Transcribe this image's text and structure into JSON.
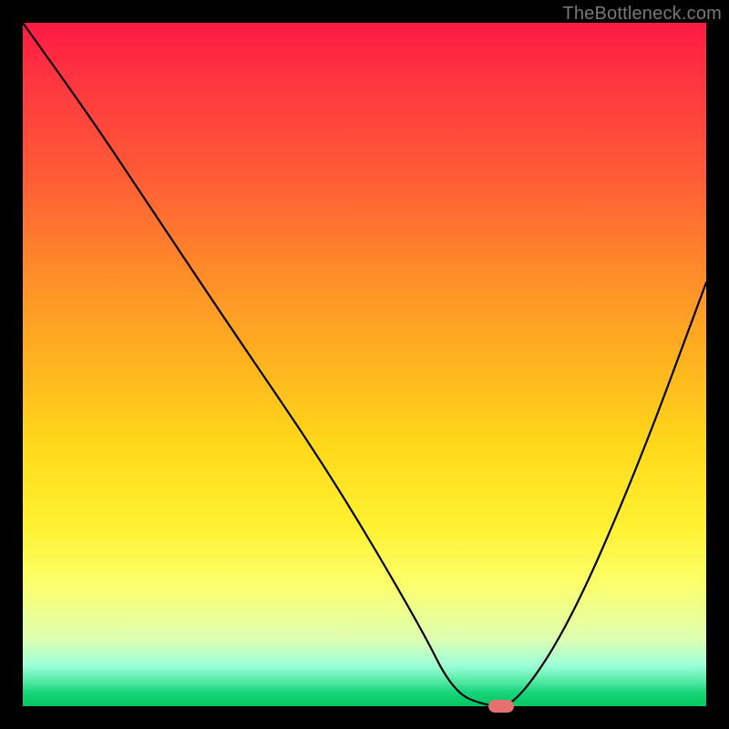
{
  "watermark": "TheBottleneck.com",
  "chart_data": {
    "type": "line",
    "title": "",
    "xlabel": "",
    "ylabel": "",
    "xlim": [
      0,
      100
    ],
    "ylim": [
      0,
      100
    ],
    "grid": false,
    "background": "red-yellow-green vertical gradient",
    "series": [
      {
        "name": "bottleneck-curve",
        "x": [
          0,
          10,
          18,
          30,
          45,
          58,
          63,
          68,
          72,
          80,
          90,
          100
        ],
        "y": [
          100,
          86,
          74,
          56,
          34,
          12,
          2,
          0,
          0,
          12,
          35,
          62
        ]
      }
    ],
    "marker": {
      "x": 70,
      "y": 0,
      "color": "#e4716f"
    },
    "gradient_stops": [
      {
        "pos": 0,
        "color": "#ff1a43"
      },
      {
        "pos": 0.5,
        "color": "#ffb41f"
      },
      {
        "pos": 0.8,
        "color": "#fff233"
      },
      {
        "pos": 1.0,
        "color": "#00c760"
      }
    ]
  }
}
